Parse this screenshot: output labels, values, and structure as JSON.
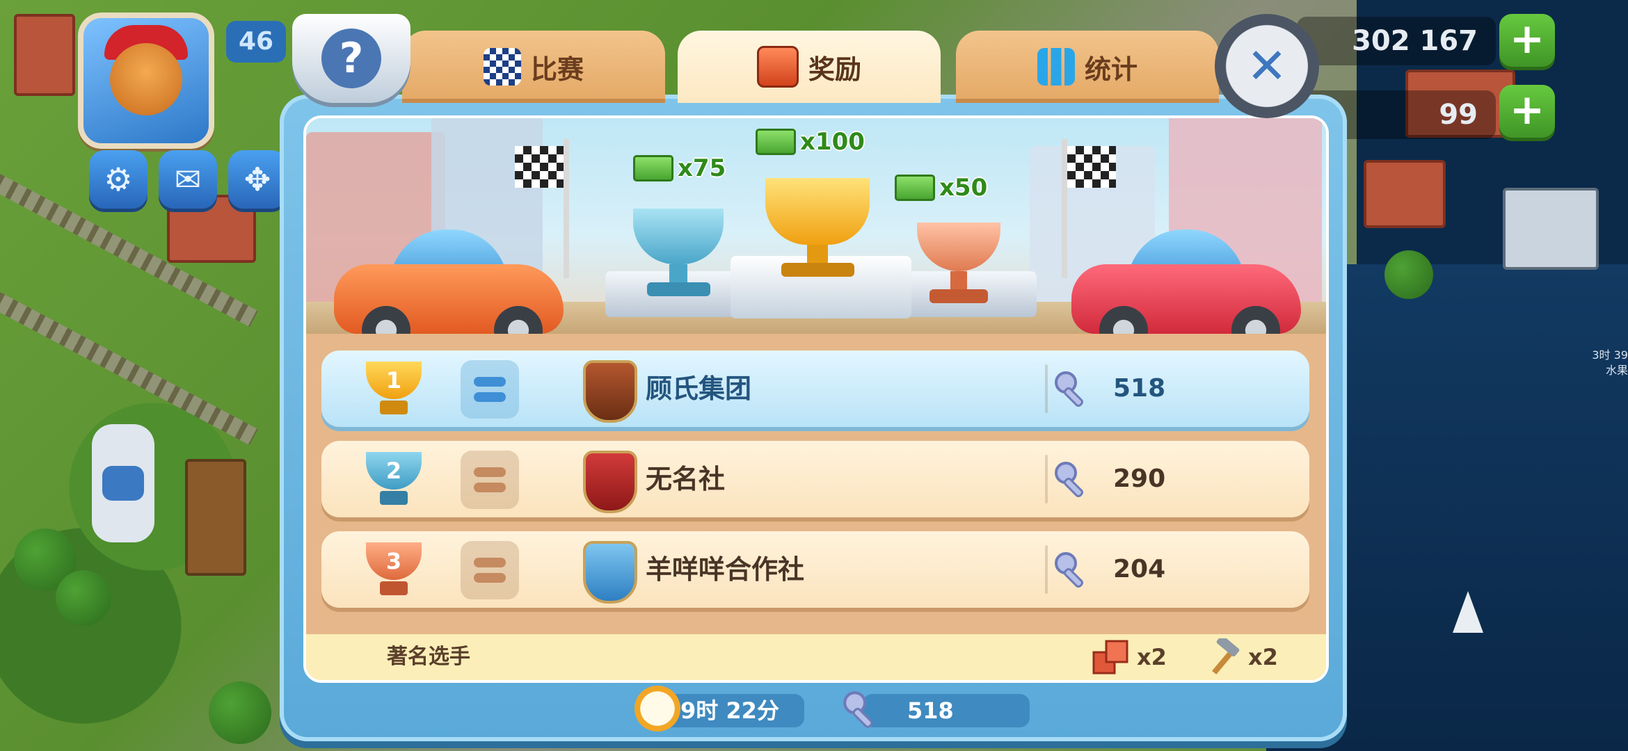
{
  "hud": {
    "level": "46",
    "currency_top": "302 167",
    "currency_second": "99",
    "plus_label": "+",
    "side_time": "3时 39",
    "side_label": "水果"
  },
  "modal": {
    "tabs": [
      {
        "label": "比赛",
        "icon": "checkered-flag-icon"
      },
      {
        "label": "奖励",
        "icon": "treasure-chest-icon"
      },
      {
        "label": "统计",
        "icon": "bar-chart-icon"
      }
    ],
    "active_tab": "奖励",
    "help_label": "?",
    "close_label": "✕",
    "banner": {
      "rewards": [
        {
          "place": 2,
          "amount": "x75"
        },
        {
          "place": 1,
          "amount": "x100"
        },
        {
          "place": 3,
          "amount": "x50"
        }
      ]
    },
    "leaderboard": [
      {
        "rank": "1",
        "team": "顾氏集团",
        "score": "518",
        "highlight": true
      },
      {
        "rank": "2",
        "team": "无名社",
        "score": "290",
        "highlight": false
      },
      {
        "rank": "3",
        "team": "羊咩咩合作社",
        "score": "204",
        "highlight": false
      }
    ],
    "footer": {
      "label": "著名选手",
      "prizes": [
        {
          "icon": "brick-icon",
          "count": "x2"
        },
        {
          "icon": "hammer-icon",
          "count": "x2"
        }
      ]
    },
    "status": {
      "time_left": "9时 22分",
      "my_score": "518"
    }
  },
  "colors": {
    "gold": "#f5b21b",
    "silver_blue": "#59b3d9",
    "bronze": "#e27a4a",
    "tab_active": "#fde8c2",
    "row_highlight": "#b9e3f7"
  }
}
